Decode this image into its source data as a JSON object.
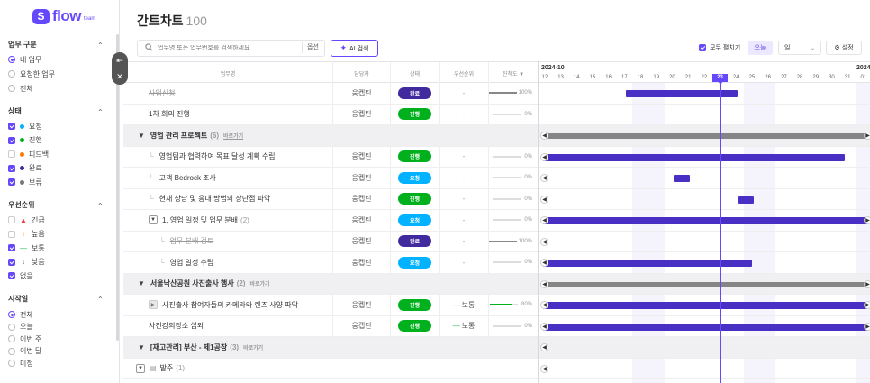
{
  "logo": {
    "word": "flow",
    "team": "team"
  },
  "sidebar": {
    "work_type": {
      "title": "업무 구분",
      "options": [
        "내 업무",
        "요청한 업무",
        "전체"
      ]
    },
    "status": {
      "title": "상태",
      "options": [
        {
          "label": "요청",
          "color": "#00b2ff",
          "checked": true
        },
        {
          "label": "진행",
          "color": "#00b01c",
          "checked": true
        },
        {
          "label": "피드백",
          "color": "#fd7900",
          "checked": false
        },
        {
          "label": "완료",
          "color": "#402a9d",
          "checked": true
        },
        {
          "label": "보류",
          "color": "#777777",
          "checked": true
        }
      ]
    },
    "priority": {
      "title": "우선순위",
      "options": [
        {
          "label": "긴급",
          "icon": "siren-icon",
          "glyph": "▲",
          "color": "#e83a3a",
          "checked": false
        },
        {
          "label": "높음",
          "icon": "arrow-up-icon",
          "glyph": "↑",
          "color": "#fd7900",
          "checked": false
        },
        {
          "label": "보통",
          "icon": "dash-icon",
          "glyph": "—",
          "color": "#1cb653",
          "checked": true
        },
        {
          "label": "낮음",
          "icon": "arrow-down-icon",
          "glyph": "↓",
          "color": "#666666",
          "checked": true
        },
        {
          "label": "없음",
          "icon": "",
          "glyph": "",
          "color": "",
          "checked": true
        }
      ]
    },
    "start_date": {
      "title": "시작일",
      "options": [
        "전체",
        "오늘",
        "이번 주",
        "이번 달",
        "미정"
      ]
    }
  },
  "header": {
    "title": "간트차트",
    "count": "100",
    "search_placeholder": "업무명 또는 업무번호를 검색하세요",
    "search_option": "옵션",
    "ai_search": "AI 검색",
    "expand_all": "모두 펼치기",
    "today": "오늘",
    "unit": "일",
    "settings": "설정"
  },
  "columns": {
    "name": "업무명",
    "owner": "담당자",
    "status": "상태",
    "priority": "우선순위",
    "progress": "진척도 ▼"
  },
  "rows": [
    {
      "type": "task",
      "name": "사업신청",
      "strike": true,
      "indent": 0,
      "owner": "웅켑틴",
      "status": "완료",
      "status_color": "#402a9d",
      "priority": "-",
      "progress": "100%",
      "pct": 100,
      "pcolor": "#888888"
    },
    {
      "type": "task",
      "name": "1차 회의 진행",
      "indent": 0,
      "owner": "웅켑틴",
      "status": "진행",
      "status_color": "#00b01c",
      "priority": "-",
      "progress": "0%",
      "pct": 0,
      "pcolor": "#888888"
    },
    {
      "type": "group",
      "name": "영업 관리 프로젝트",
      "count": "(6)",
      "goto": "바로가기"
    },
    {
      "type": "task",
      "name": "영업팀과 협력하여 목표 달성 계획 수립",
      "indent": 1,
      "owner": "웅켑틴",
      "status": "진행",
      "status_color": "#00b01c",
      "priority": "-",
      "progress": "0%",
      "pct": 0,
      "pcolor": "#888888"
    },
    {
      "type": "task",
      "name": "고객 Bedrock 조사",
      "indent": 1,
      "owner": "웅켑틴",
      "status": "요청",
      "status_color": "#00b2ff",
      "priority": "-",
      "progress": "0%",
      "pct": 0,
      "pcolor": "#888888"
    },
    {
      "type": "task",
      "name": "현재 상담 및 응대 방법의 장단점 파악",
      "indent": 1,
      "owner": "웅켑틴",
      "status": "진행",
      "status_color": "#00b01c",
      "priority": "-",
      "progress": "0%",
      "pct": 0,
      "pcolor": "#888888"
    },
    {
      "type": "parent",
      "name": "1. 영업 일정 및 업무 분배",
      "count": "(2)",
      "indent": 1,
      "owner": "웅켑틴",
      "status": "요청",
      "status_color": "#00b2ff",
      "priority": "-",
      "progress": "0%",
      "pct": 0,
      "pcolor": "#888888"
    },
    {
      "type": "task",
      "name": "업무 분배 검토",
      "strike": true,
      "indent": 2,
      "owner": "웅켑틴",
      "status": "완료",
      "status_color": "#402a9d",
      "priority": "-",
      "progress": "100%",
      "pct": 100,
      "pcolor": "#888888"
    },
    {
      "type": "task",
      "name": "영업 일정 수립",
      "indent": 2,
      "owner": "웅켑틴",
      "status": "요청",
      "status_color": "#00b2ff",
      "priority": "-",
      "progress": "0%",
      "pct": 0,
      "pcolor": "#888888"
    },
    {
      "type": "group",
      "name": "서울낙산공원 사진출사 행사",
      "count": "(2)",
      "goto": "바로가기"
    },
    {
      "type": "parent2",
      "name": "사진출사 참여자들의 카메라와 렌즈 사양 파악",
      "indent": 1,
      "owner": "웅켑틴",
      "status": "진행",
      "status_color": "#00b01c",
      "priority": "보통",
      "progress": "80%",
      "pct": 80,
      "pcolor": "#00b01c"
    },
    {
      "type": "task",
      "name": "사진강의장소 섭외",
      "indent": 0,
      "owner": "웅켑틴",
      "status": "진행",
      "status_color": "#00b01c",
      "priority": "보통",
      "progress": "0%",
      "pct": 0,
      "pcolor": "#888888"
    },
    {
      "type": "group",
      "name": "[재고관리] 부산 - 제1공장",
      "count": "(3)",
      "goto": "바로가기"
    },
    {
      "type": "folder",
      "name": "발주",
      "count": "(1)"
    }
  ],
  "gantt": {
    "month1": "2024-10",
    "month2": "2024",
    "days": [
      "12",
      "13",
      "14",
      "15",
      "16",
      "17",
      "18",
      "19",
      "20",
      "21",
      "22",
      "23",
      "24",
      "25",
      "26",
      "27",
      "28",
      "29",
      "30",
      "31",
      "01"
    ],
    "today_day": "23",
    "bars": [
      {
        "row": 0,
        "start": 5.6,
        "end": 12.6,
        "kind": "task"
      },
      {
        "row": 2,
        "start": -0.5,
        "end": 20.8,
        "kind": "group"
      },
      {
        "row": 3,
        "start": -0.5,
        "end": 19.3,
        "kind": "task"
      },
      {
        "row": 4,
        "start": 8.6,
        "end": 9.6,
        "kind": "task"
      },
      {
        "row": 5,
        "start": 12.6,
        "end": 13.6,
        "kind": "task"
      },
      {
        "row": 6,
        "start": -0.5,
        "end": 20.8,
        "kind": "task"
      },
      {
        "row": 8,
        "start": -0.5,
        "end": 13.5,
        "kind": "task"
      },
      {
        "row": 9,
        "start": -0.5,
        "end": 20.8,
        "kind": "group"
      },
      {
        "row": 10,
        "start": -0.5,
        "end": 20.8,
        "kind": "task"
      },
      {
        "row": 11,
        "start": -0.5,
        "end": 20.8,
        "kind": "task"
      }
    ]
  }
}
